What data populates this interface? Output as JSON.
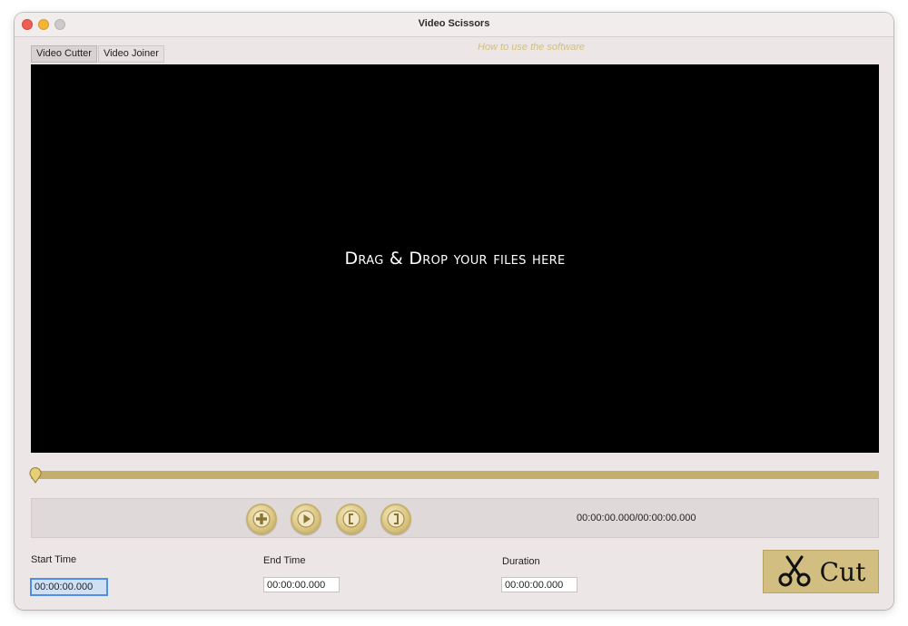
{
  "window": {
    "title": "Video Scissors"
  },
  "tabs": [
    {
      "label": "Video Cutter",
      "active": true
    },
    {
      "label": "Video Joiner",
      "active": false
    }
  ],
  "help_link": "How to use the software",
  "video_area": {
    "drop_text": "Drag & Drop your files here"
  },
  "timeline": {
    "position_fraction": 0.0
  },
  "controls": {
    "buttons": [
      {
        "name": "add",
        "icon": "plus-icon"
      },
      {
        "name": "play",
        "icon": "play-icon"
      },
      {
        "name": "set-start",
        "icon": "left-bracket-icon"
      },
      {
        "name": "set-end",
        "icon": "right-bracket-icon"
      }
    ],
    "time_readout": "00:00:00.000/00:00:00.000"
  },
  "fields": {
    "start": {
      "label": "Start Time",
      "value": "00:00:00.000"
    },
    "end": {
      "label": "End Time",
      "value": "00:00:00.000"
    },
    "duration": {
      "label": "Duration",
      "value": "00:00:00.000"
    }
  },
  "cut_button": {
    "label": "Cut",
    "icon": "scissors-icon"
  },
  "colors": {
    "accent_gold": "#d1be80",
    "timeline_gold": "#c3ae6b",
    "link_gold": "#d3bf74",
    "window_bg": "#ede6e6",
    "video_bg": "#000000"
  }
}
